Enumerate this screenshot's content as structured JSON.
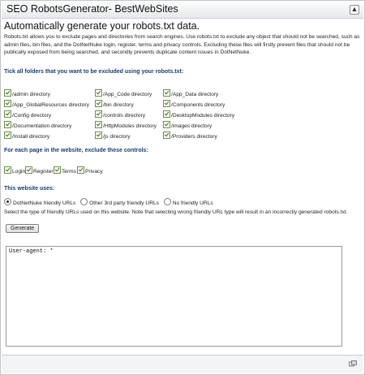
{
  "window": {
    "title": "SEO RobotsGenerator- BestWebSites"
  },
  "heading": "Automatically generate your robots.txt data.",
  "intro": "Robots.txt allows you to exclude pages and directories from search engines. Use robots.txt to exclude any object that should not be searched, such as admin files, bin files, and the DotNetNuke login, register, terms and privacy controls. Excluding these files will firstly prevent files that should not be publically exposed from being searched, and secondly prevents duplicate content issues in DotNetNuke.",
  "folders": {
    "heading": "Tick all folders that you want to be excluded using your robots.txt:",
    "col1": [
      "/admin directory",
      "/App_GlobalResources directory",
      "/Config directory",
      "/Documentation directory",
      "/Install directory"
    ],
    "col2": [
      "/App_Code directory",
      "/bin directory",
      "/controls directory",
      "/HttpModules directory",
      "/js directory"
    ],
    "col3": [
      "/App_Data directory",
      "/Components directory",
      "/DesktopModules directory",
      "/images directory",
      "/Providers directory"
    ]
  },
  "controls": {
    "heading": "For each page in the website, exclude these controls:",
    "items": [
      "Login",
      "Register",
      "Terms",
      "Privacy"
    ]
  },
  "website": {
    "heading": "This website uses:",
    "options": [
      "DotNetNuke friendly URLs",
      "Other 3rd party friendly URLs",
      "No friendly URLs"
    ],
    "selected": "DotNetNuke friendly URLs",
    "note": "Select the type of friendly URLs used on this website. Note that selecting wrong friendly URL type will result in an incorrectly generated robots.txt."
  },
  "generate_label": "Generate",
  "output": {
    "value": "User-agent: *"
  },
  "icons": {
    "collapse": "collapse-icon",
    "footer": "settings-icon"
  },
  "colors": {
    "accent": "#1c3d6e",
    "checkbox": "#2e6b15"
  }
}
